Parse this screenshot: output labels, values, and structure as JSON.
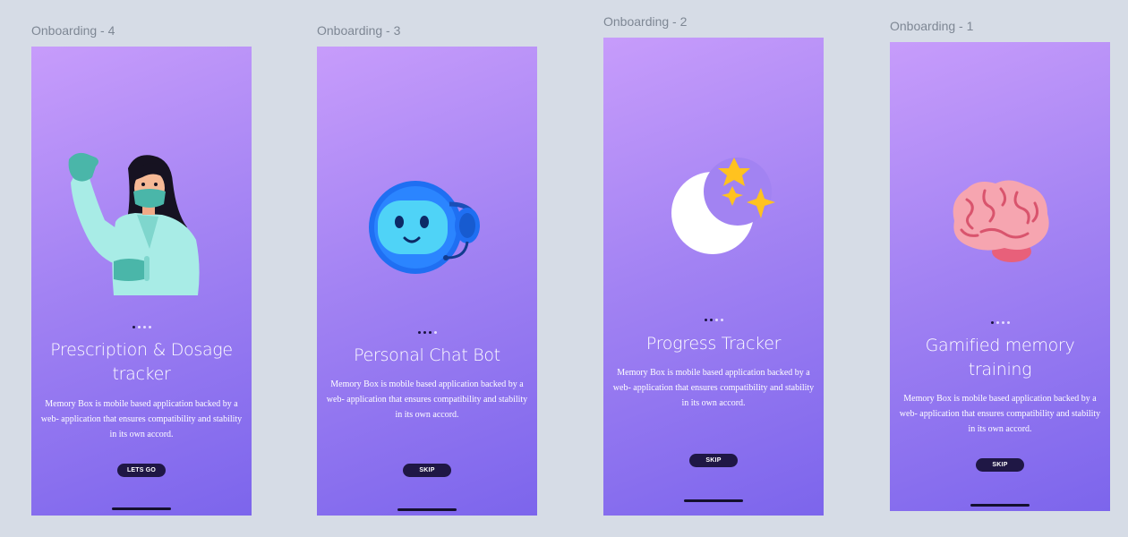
{
  "frames": [
    {
      "label": "Onboarding - 4",
      "title": "Prescription & Dosage tracker",
      "description": "Memory Box is mobile based application backed by a web- application that ensures compatibility and stability in its own accord.",
      "button_label": "LETS GO",
      "illustration": "doctor-illustration",
      "active_dot": 1
    },
    {
      "label": "Onboarding - 3",
      "title": "Personal Chat Bot",
      "description": "Memory Box is mobile based application backed by a web- application that ensures compatibility and stability in its own accord.",
      "button_label": "SKIP",
      "illustration": "chatbot-illustration",
      "active_dot": 3
    },
    {
      "label": "Onboarding - 2",
      "title": "Progress Tracker",
      "description": "Memory Box is mobile based application backed by a web- application that ensures compatibility and stability in its own accord.",
      "button_label": "SKIP",
      "illustration": "moon-stars-illustration",
      "active_dot": 2
    },
    {
      "label": "Onboarding - 1",
      "title": "Gamified memory training",
      "description": "Memory Box is mobile based application backed by a web- application that ensures compatibility and stability in its own accord.",
      "button_label": "SKIP",
      "illustration": "brain-illustration",
      "active_dot": 1
    }
  ],
  "colors": {
    "canvas_bg": "#d6dce6",
    "gradient_start": "#c79cfb",
    "gradient_end": "#7c65ec",
    "button_bg": "#1f1745",
    "text": "#ffffff"
  }
}
